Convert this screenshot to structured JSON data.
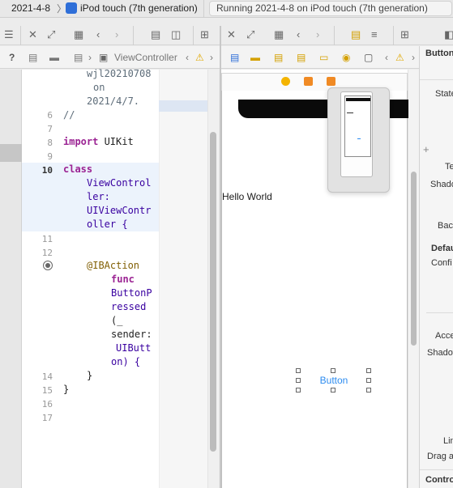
{
  "titlebar": {
    "scheme": "2021-4-8",
    "device": "iPod touch (7th generation)",
    "status": "Running 2021-4-8 on iPod touch (7th generation)"
  },
  "jumpbar": {
    "file": "ViewController"
  },
  "editor": {
    "lines": [
      {
        "num": "6",
        "text": "//"
      },
      {
        "num": "7",
        "text": ""
      },
      {
        "num": "8",
        "text": "import UIKit"
      },
      {
        "num": "9",
        "text": ""
      },
      {
        "num": "10",
        "text": "class"
      },
      {
        "num": "11",
        "text": ""
      },
      {
        "num": "12",
        "text": ""
      },
      {
        "num": "14",
        "text": "}"
      },
      {
        "num": "15",
        "text": "}"
      },
      {
        "num": "16",
        "text": ""
      },
      {
        "num": "17",
        "text": ""
      }
    ],
    "header_comment": [
      "wjl20210708",
      "on",
      "2021/4/7."
    ],
    "class_decl": [
      "ViewControl",
      "ler:",
      "UIViewContr",
      "oller {"
    ],
    "action": {
      "attr": "@IBAction",
      "func": "func",
      "name_1": "ButtonP",
      "name_2": "ressed",
      "paren": "(_",
      "sender": "sender:",
      "type_1": "UIButt",
      "type_2": "on) {"
    }
  },
  "canvas": {
    "label": "Hello World",
    "button": "Button"
  },
  "inspector": {
    "items": [
      "Button",
      "State",
      "Te",
      "Shado",
      "Bac",
      "Defau",
      "Confi",
      "Acce",
      "Shadow",
      "Lin",
      "Drag a",
      "Contro"
    ]
  },
  "colors": {
    "keyword": "#9b2393",
    "type": "#3900a0",
    "attribute": "#815f03",
    "link_blue": "#2d8cf0"
  }
}
